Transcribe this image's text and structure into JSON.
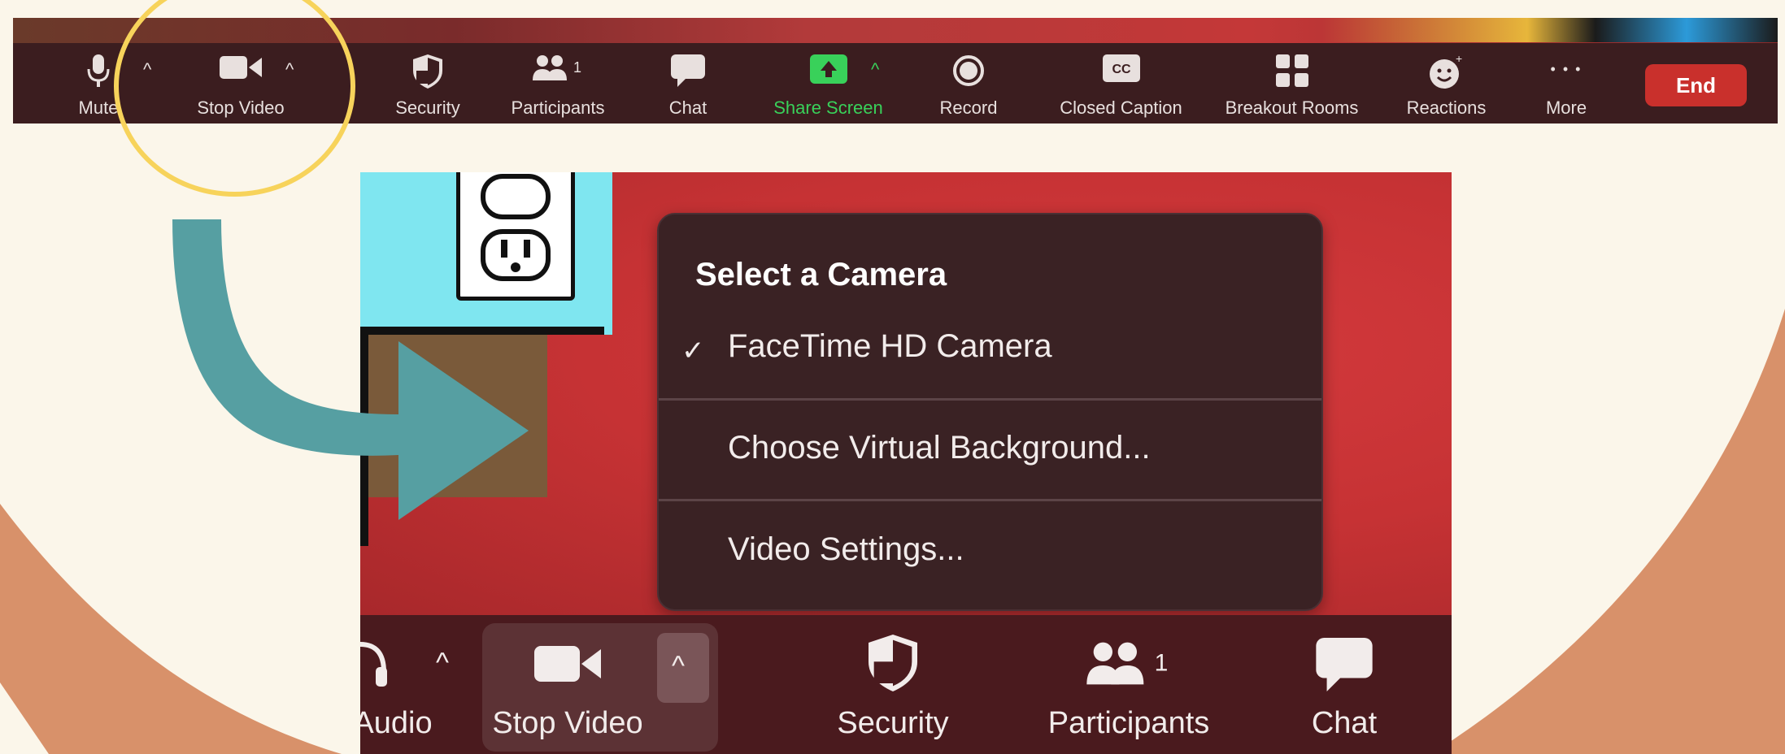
{
  "colors": {
    "background": "#fbf6ea",
    "arc": "#d8916a",
    "toolbar": "#3b1d1f",
    "highlight_circle": "#f7d35b",
    "arrow": "#569fa2",
    "end_button": "#c9302c",
    "share_green": "#39d15a"
  },
  "top_toolbar": {
    "items": [
      {
        "label": "Mute",
        "icon": "microphone-icon"
      },
      {
        "label": "Stop Video",
        "icon": "video-camera-icon"
      },
      {
        "label": "Security",
        "icon": "shield-icon"
      },
      {
        "label": "Participants",
        "icon": "participants-icon",
        "count": "1"
      },
      {
        "label": "Chat",
        "icon": "chat-bubble-icon"
      },
      {
        "label": "Share Screen",
        "icon": "share-screen-icon"
      },
      {
        "label": "Record",
        "icon": "record-icon"
      },
      {
        "label": "Closed Caption",
        "icon": "closed-caption-icon",
        "badge": "CC"
      },
      {
        "label": "Breakout Rooms",
        "icon": "breakout-rooms-icon"
      },
      {
        "label": "Reactions",
        "icon": "reactions-icon"
      },
      {
        "label": "More",
        "icon": "more-dots-icon",
        "glyph": "• • •"
      }
    ],
    "end_label": "End"
  },
  "camera_menu": {
    "heading": "Select a Camera",
    "check": "✓",
    "items": [
      {
        "label": "FaceTime HD Camera",
        "selected": true
      },
      {
        "label": "Choose Virtual Background..."
      },
      {
        "label": "Video Settings..."
      }
    ]
  },
  "bottom_toolbar": {
    "items": [
      {
        "label": "Audio",
        "icon": "headphones-icon"
      },
      {
        "label": "Stop Video",
        "icon": "video-camera-icon"
      },
      {
        "label": "Security",
        "icon": "shield-icon"
      },
      {
        "label": "Participants",
        "icon": "participants-icon",
        "count": "1"
      },
      {
        "label": "Chat",
        "icon": "chat-bubble-icon"
      }
    ]
  }
}
